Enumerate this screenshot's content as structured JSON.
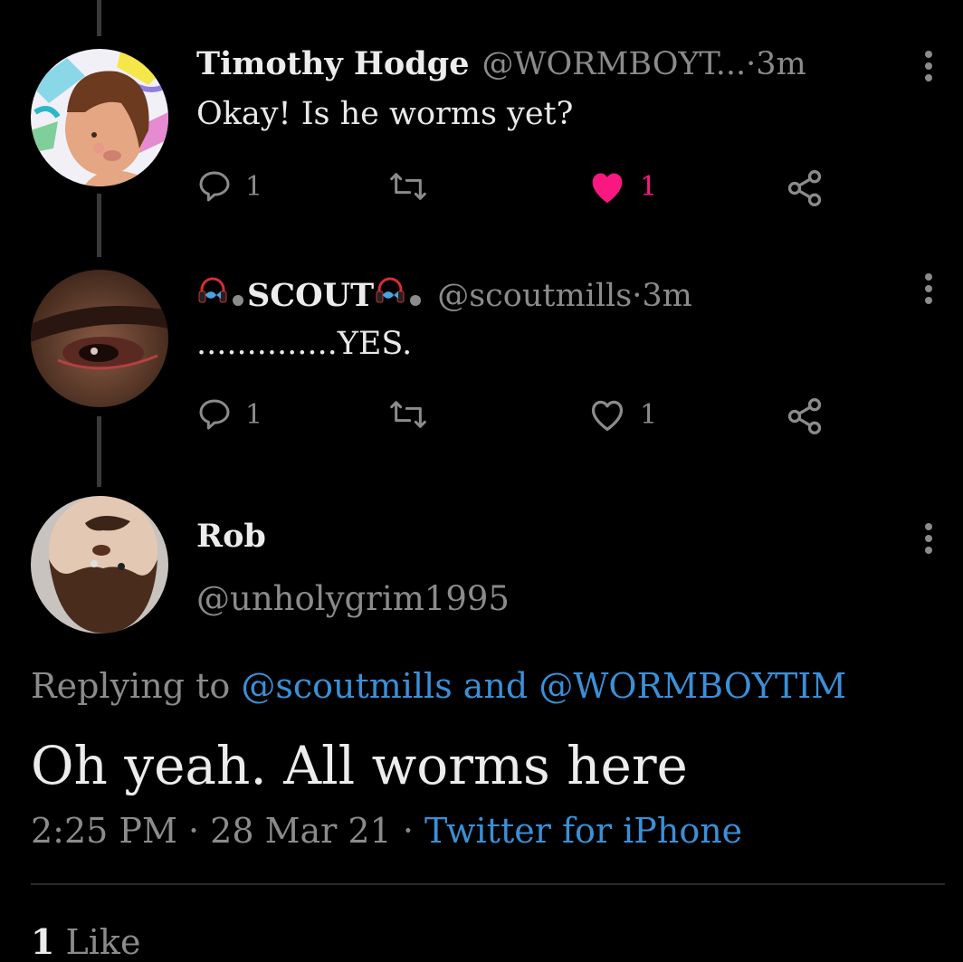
{
  "tweets": [
    {
      "display_name": "Timothy Hodge",
      "handle": "@WORMBOYT...",
      "sep": " · ",
      "time": "3m",
      "text": "Okay! Is he worms yet?",
      "replies": "1",
      "retweets": "",
      "likes": "1",
      "liked": true
    },
    {
      "display_name": "SCOUT",
      "handle": "@scoutmills",
      "sep": " · ",
      "time": "3m",
      "text": "..............YES.",
      "replies": "1",
      "retweets": "",
      "likes": "1",
      "liked": false
    }
  ],
  "focused": {
    "display_name": "Rob",
    "handle": "@unholygrim1995",
    "replying_prefix": "Replying to ",
    "replying_user1": "@scoutmills",
    "replying_and": " and ",
    "replying_user2": "@WORMBOYTIM",
    "text": "Oh yeah. All worms here",
    "time": "2:25 PM",
    "sep1": " · ",
    "date": "28 Mar 21",
    "sep2": " · ",
    "source": "Twitter for iPhone",
    "likes_count": "1",
    "likes_label": " Like"
  },
  "colors": {
    "like": "#f91880",
    "link": "#3b8fd6",
    "muted": "#8b8b8b"
  },
  "icons": [
    "reply-icon",
    "retweet-icon",
    "heart-icon",
    "share-icon",
    "more-icon",
    "fish-emoji-icon",
    "headphones-emoji-icon"
  ]
}
